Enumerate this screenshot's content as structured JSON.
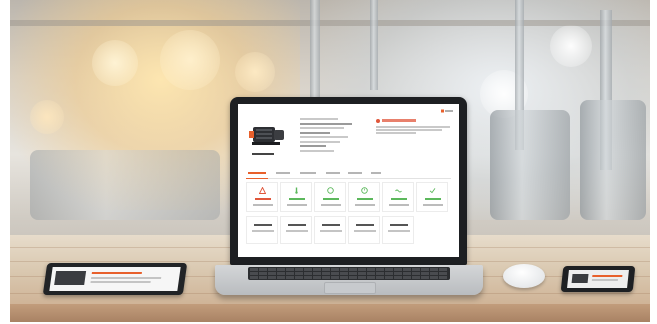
{
  "scene": {
    "description_tags": [
      "industrial-kitchen-backdrop",
      "wooden-table",
      "laptop",
      "tablet",
      "mouse",
      "smartphone"
    ]
  },
  "laptop_screen": {
    "brand_color": "#e8602c",
    "alert_color": "#e0563b",
    "kpi_colors": [
      "#e0563b",
      "#5cb85c",
      "#5cb85c",
      "#5cb85c",
      "#5cb85c",
      "#5cb85c"
    ]
  }
}
